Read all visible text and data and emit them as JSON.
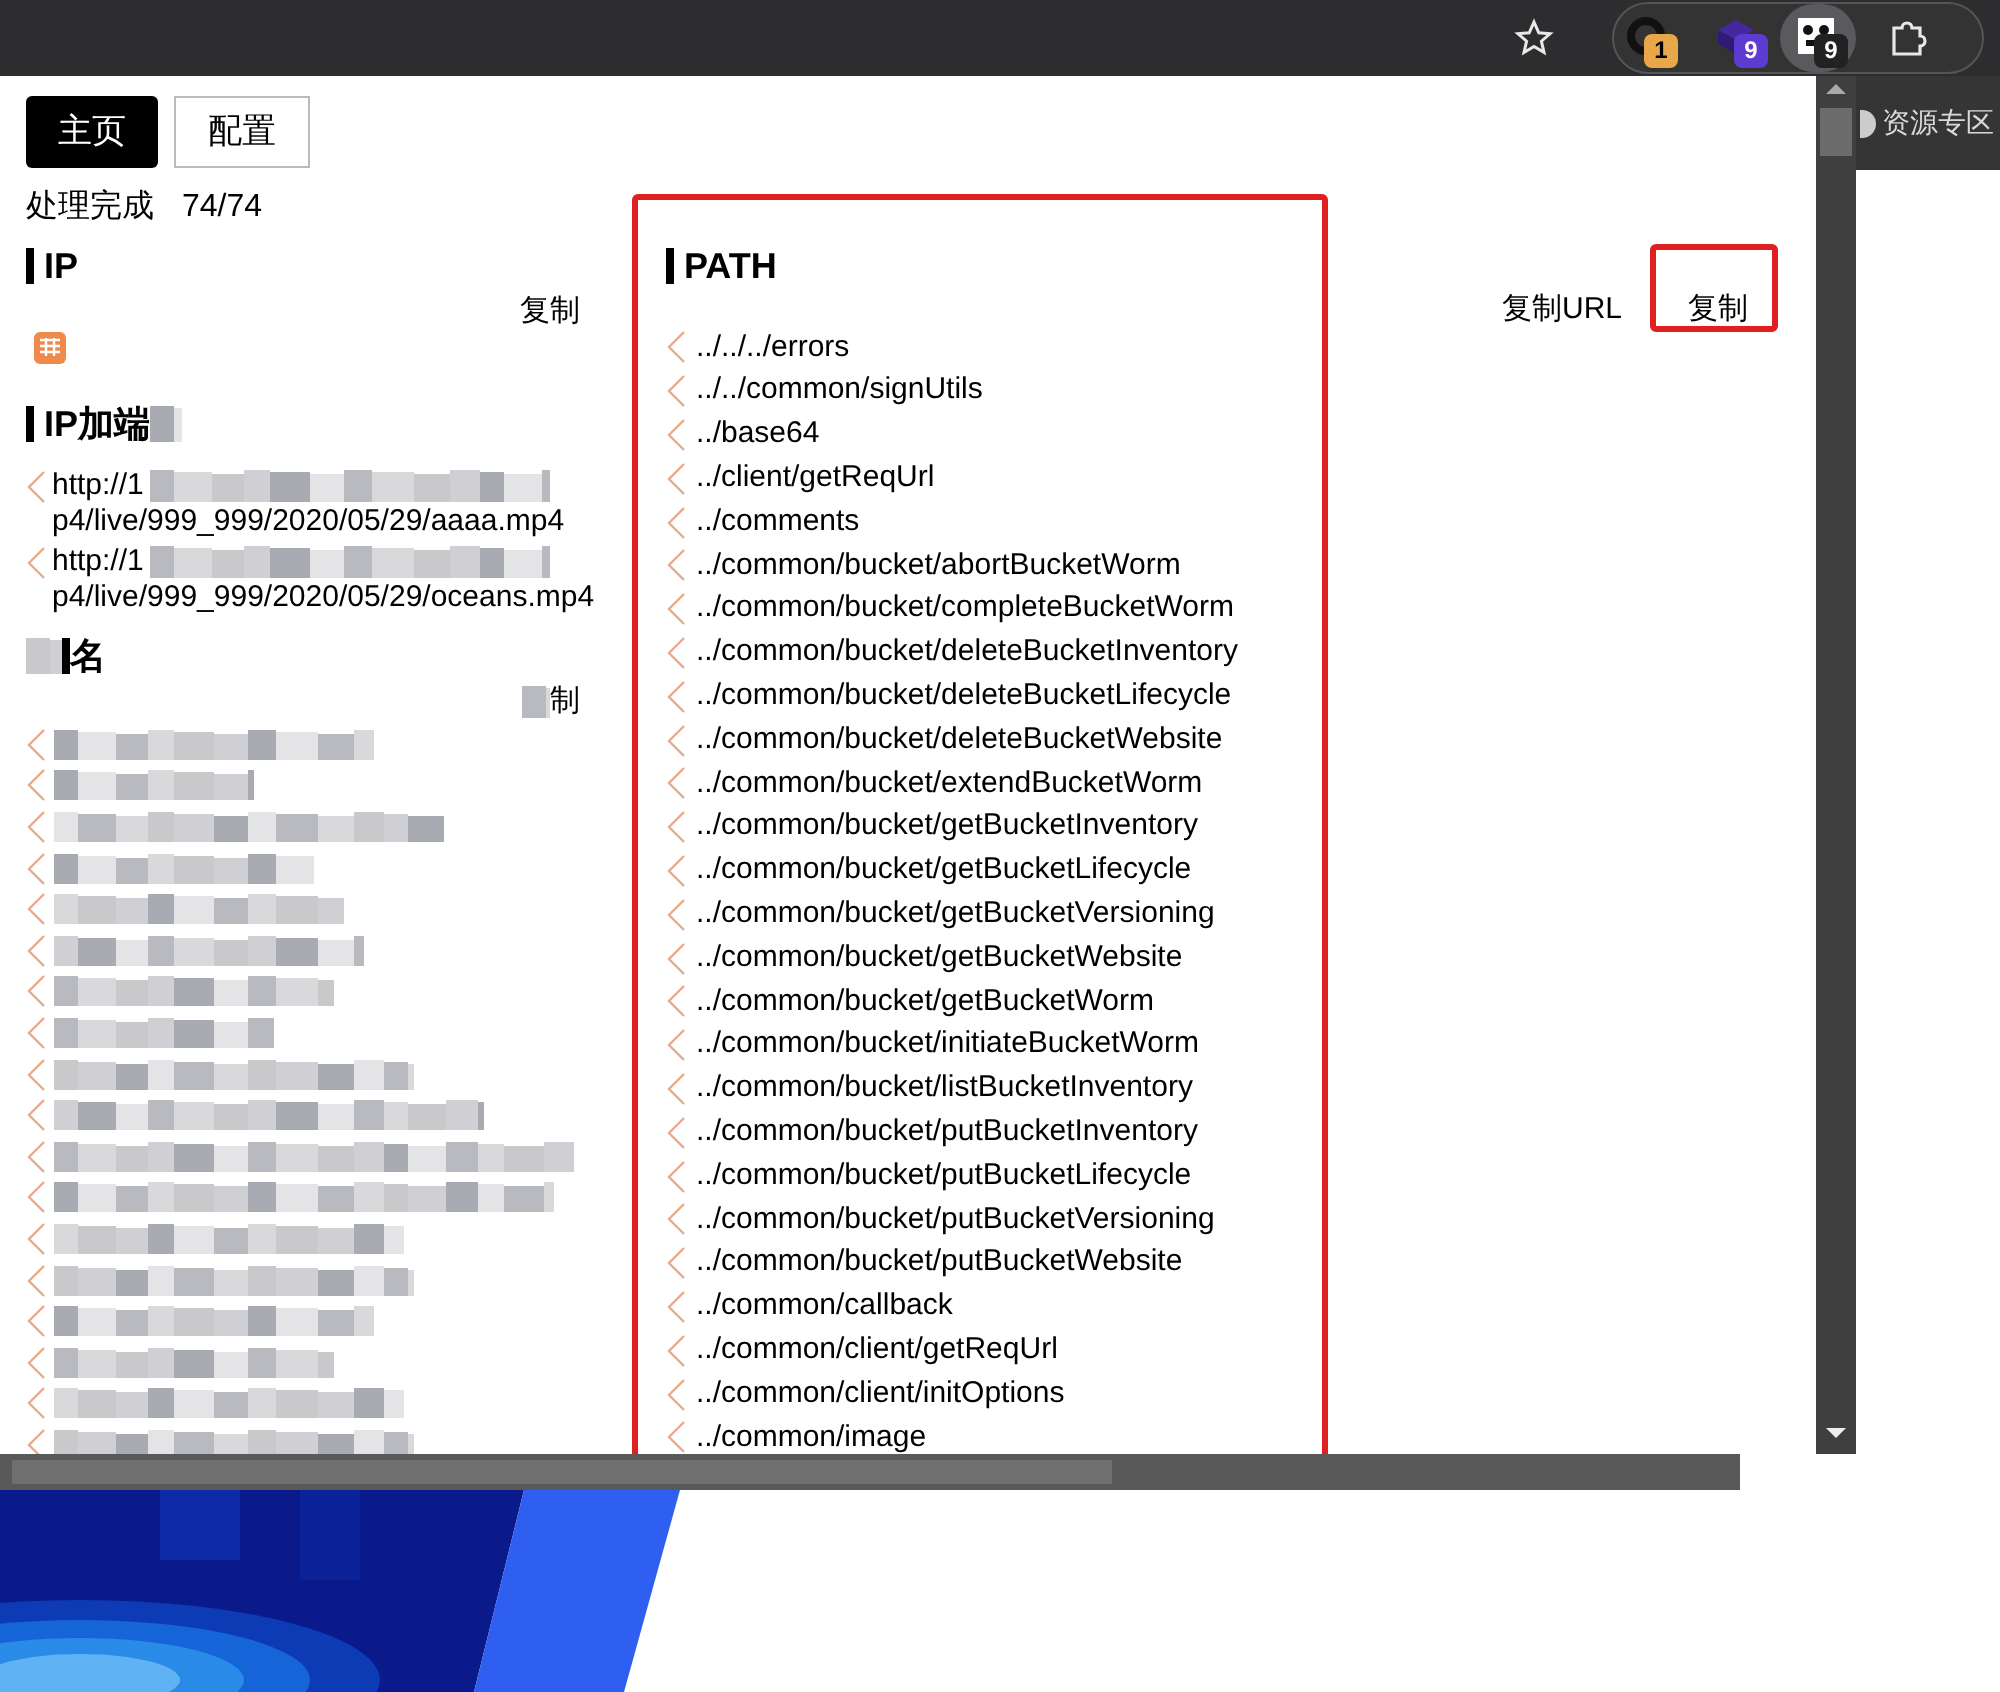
{
  "toolbar": {
    "extension_badges": [
      "1",
      "9",
      "9"
    ]
  },
  "tabs": [
    {
      "label": "主页",
      "selected": true
    },
    {
      "label": "配置",
      "selected": false
    }
  ],
  "status": {
    "label": "处理完成",
    "count": "74/74"
  },
  "ip": {
    "title": "IP",
    "copy_button": "复制"
  },
  "ip_port": {
    "title": "IP加端",
    "lines": [
      {
        "prefix": "http://1",
        "suffix": "p4/live/999_999/2020/05/29/aaaa.mp4"
      },
      {
        "prefix": "http://1",
        "suffix": "p4/live/999_999/2020/05/29/oceans.mp4"
      }
    ]
  },
  "domain": {
    "title": "名",
    "copy_button": "制",
    "items": [
      {
        "kind": "redacted"
      },
      {
        "kind": "redacted"
      },
      {
        "kind": "redacted"
      },
      {
        "kind": "redacted"
      },
      {
        "kind": "redacted"
      },
      {
        "kind": "redacted"
      },
      {
        "kind": "redacted"
      },
      {
        "kind": "redacted"
      },
      {
        "kind": "redacted"
      },
      {
        "kind": "redacted"
      },
      {
        "kind": "redacted"
      },
      {
        "kind": "redacted"
      },
      {
        "kind": "redacted"
      },
      {
        "kind": "redacted"
      },
      {
        "kind": "redacted"
      },
      {
        "kind": "redacted"
      },
      {
        "kind": "redacted"
      },
      {
        "kind": "redacted"
      }
    ]
  },
  "path": {
    "title": "PATH",
    "highlighted": true,
    "copy_url_button": "复制URL",
    "copy_button": {
      "label": "复制",
      "highlighted": true
    },
    "items": [
      "../../../errors",
      "../../common/signUtils",
      "../base64",
      "../client/getReqUrl",
      "../comments",
      "../common/bucket/abortBucketWorm",
      "../common/bucket/completeBucketWorm",
      "../common/bucket/deleteBucketInventory",
      "../common/bucket/deleteBucketLifecycle",
      "../common/bucket/deleteBucketWebsite",
      "../common/bucket/extendBucketWorm",
      "../common/bucket/getBucketInventory",
      "../common/bucket/getBucketLifecycle",
      "../common/bucket/getBucketVersioning",
      "../common/bucket/getBucketWebsite",
      "../common/bucket/getBucketWorm",
      "../common/bucket/initiateBucketWorm",
      "../common/bucket/listBucketInventory",
      "../common/bucket/putBucketInventory",
      "../common/bucket/putBucketLifecycle",
      "../common/bucket/putBucketVersioning",
      "../common/bucket/putBucketWebsite",
      "../common/callback",
      "../common/client/getReqUrl",
      "../common/client/initOptions",
      "../common/image"
    ]
  },
  "page_behind": {
    "link": "资源专区"
  }
}
